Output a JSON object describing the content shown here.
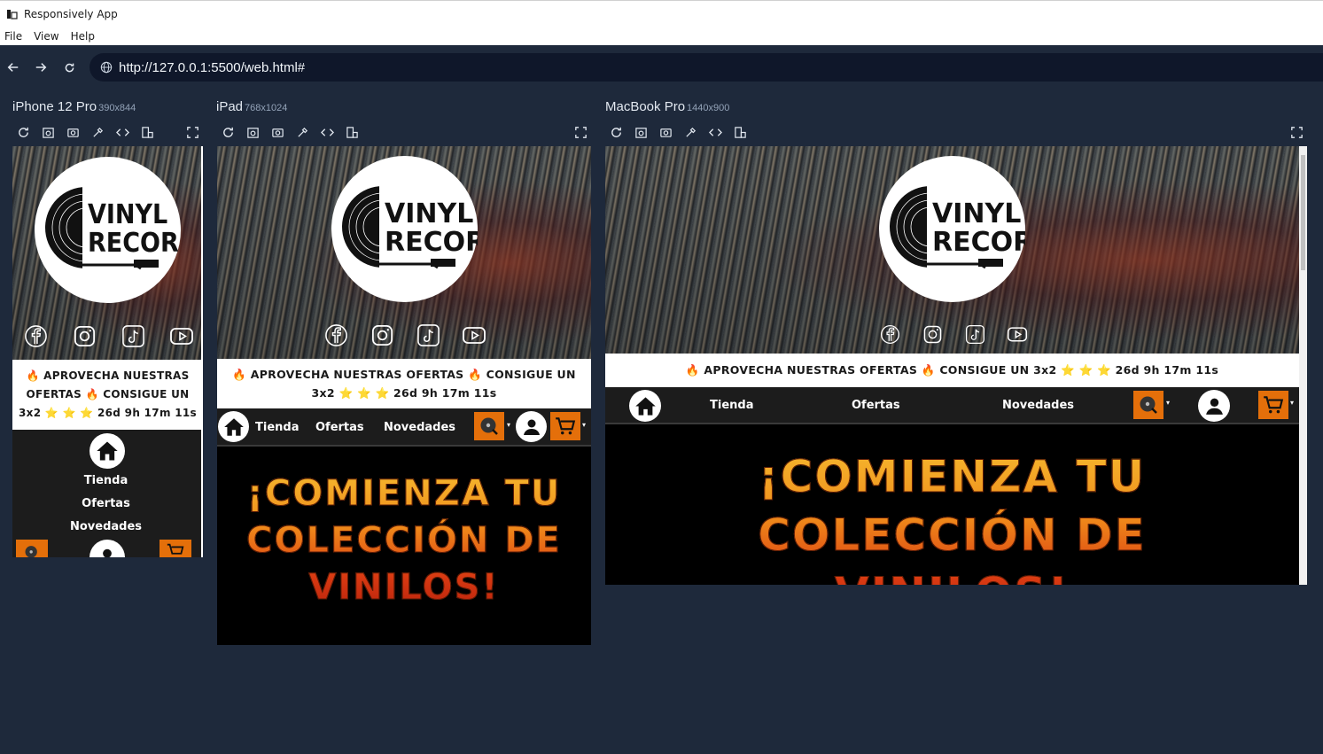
{
  "window": {
    "title": "Responsively App"
  },
  "menu": [
    "File",
    "View",
    "Help"
  ],
  "address": {
    "url": "http://127.0.0.1:5500/web.html#"
  },
  "devices": [
    {
      "name": "iPhone 12 Pro",
      "res": "390x844"
    },
    {
      "name": "iPad",
      "res": "768x1024"
    },
    {
      "name": "MacBook Pro",
      "res": "1440x900"
    }
  ],
  "site": {
    "logo_line1": "VINYL",
    "logo_line2": "RECORD",
    "promo": "🔥 APROVECHA NUESTRAS OFERTAS 🔥  CONSIGUE UN 3x2 ⭐ ⭐ ⭐  26d 9h 17m 11s",
    "promo_phone_l1": "🔥 APROVECHA NUESTRAS",
    "promo_phone_l2": "OFERTAS 🔥  CONSIGUE UN",
    "promo_phone_l3": "3x2 ⭐ ⭐ ⭐  26d 9h 17m 11s",
    "promo_ipad_l1": "🔥 APROVECHA NUESTRAS OFERTAS 🔥  CONSIGUE UN",
    "promo_ipad_l2": "3x2 ⭐ ⭐ ⭐  26d 9h 17m 11s",
    "nav": {
      "tienda": "Tienda",
      "ofertas": "Ofertas",
      "novedades": "Novedades"
    },
    "headline_l1": "¡COMIENZA TU",
    "headline_l2": "COLECCIÓN DE",
    "headline_l3": "VINILOS!",
    "social_icons": [
      "facebook-icon",
      "instagram-icon",
      "tiktok-icon",
      "youtube-icon"
    ]
  },
  "colors": {
    "accent": "#e46f0a",
    "background": "#1e293b"
  }
}
